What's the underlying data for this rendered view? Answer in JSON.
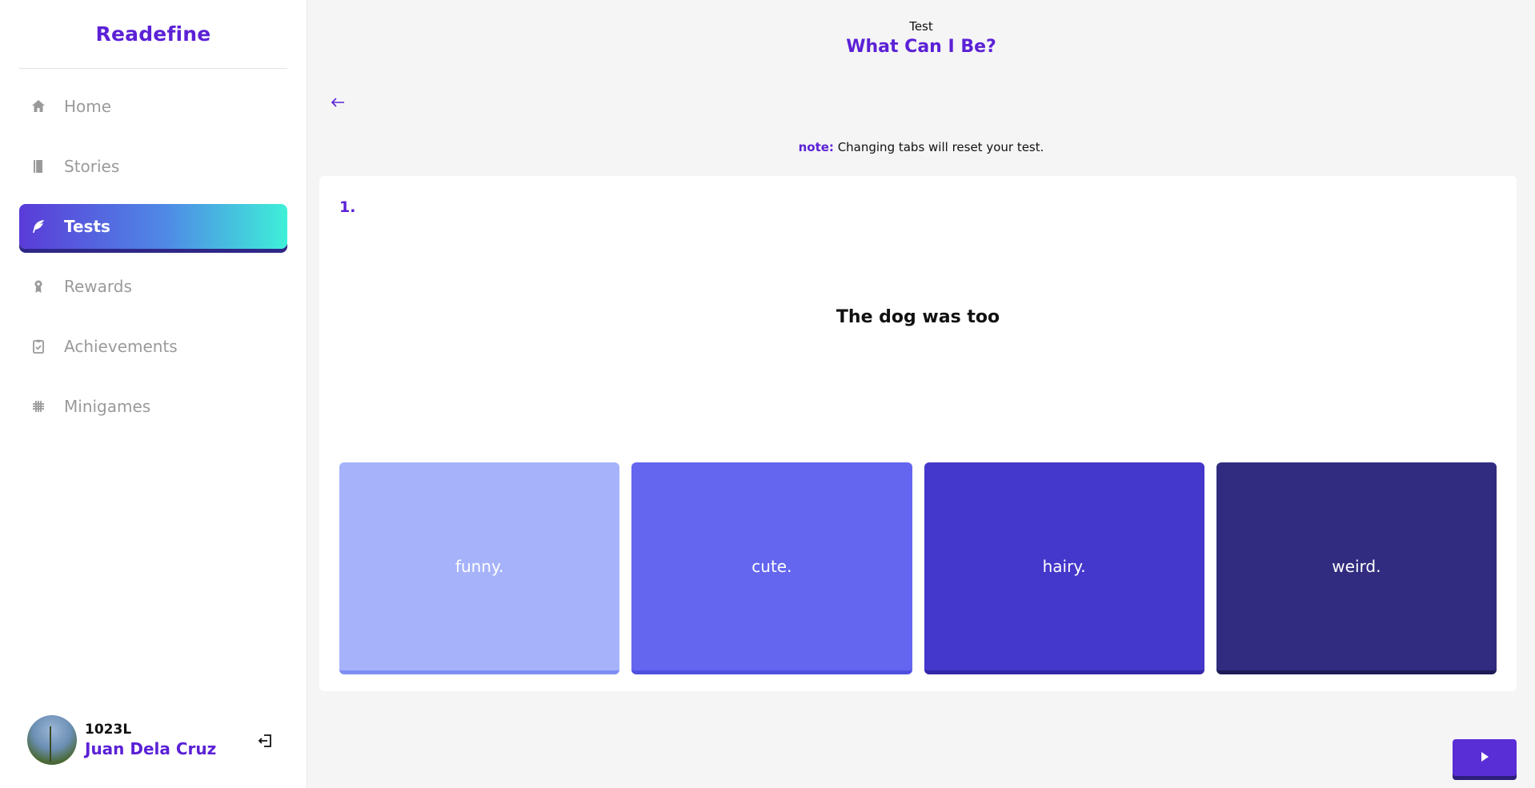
{
  "sidebar": {
    "brand": "Readefine",
    "items": [
      {
        "label": "Home",
        "icon": "home-icon"
      },
      {
        "label": "Stories",
        "icon": "book-icon"
      },
      {
        "label": "Tests",
        "icon": "feather-icon",
        "active": true
      },
      {
        "label": "Rewards",
        "icon": "award-icon"
      },
      {
        "label": "Achievements",
        "icon": "clipboard-check-icon"
      },
      {
        "label": "Minigames",
        "icon": "grid-icon"
      }
    ],
    "user": {
      "code": "1023L",
      "name": "Juan Dela Cruz"
    }
  },
  "header": {
    "subtitle": "Test",
    "title": "What Can I Be?"
  },
  "note": {
    "label": "note:",
    "text": " Changing tabs will reset your test."
  },
  "question": {
    "number": "1.",
    "text": "The dog was too",
    "options": [
      "funny.",
      "cute.",
      "hairy.",
      "weird."
    ]
  },
  "colors": {
    "accent": "#5b21d6",
    "option_1": "#a6b3fb",
    "option_2": "#6466ef",
    "option_3": "#4437cb",
    "option_4": "#312c80"
  }
}
